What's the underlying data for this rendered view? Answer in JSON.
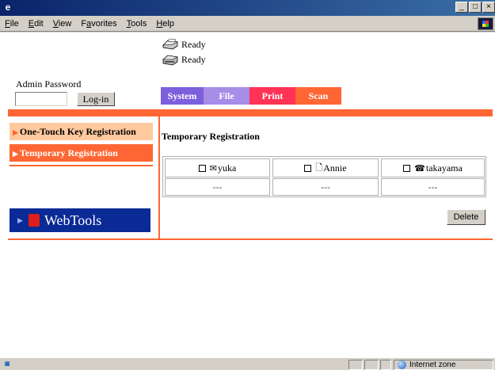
{
  "menu": {
    "items": [
      "File",
      "Edit",
      "View",
      "Favorites",
      "Tools",
      "Help"
    ],
    "underlines": [
      "F",
      "E",
      "V",
      "a",
      "T",
      "H"
    ]
  },
  "status": {
    "line1": "Ready",
    "line2": "Ready"
  },
  "admin": {
    "label": "Admin Password",
    "password_value": "",
    "login_label": "Log-in"
  },
  "tabs": [
    {
      "label": "System",
      "color": "#7b5fdc"
    },
    {
      "label": "File",
      "color": "#a78ce8"
    },
    {
      "label": "Print",
      "color": "#ff3355"
    },
    {
      "label": "Scan",
      "color": "#ff6633"
    }
  ],
  "sidebar": {
    "items": [
      {
        "label": "One-Touch Key Registration",
        "bg": "#ffc99e",
        "fg": "#000000",
        "arrow_color": "#ff6633"
      },
      {
        "label": "Temporary Registration",
        "bg": "#ff6633",
        "fg": "#ffffff",
        "arrow_color": "#ffffff"
      }
    ],
    "webtools_label": "WebTools"
  },
  "main": {
    "title": "Temporary Registration",
    "registrations": [
      {
        "name": "yuka",
        "icon": "mail-icon",
        "glyph": "✉"
      },
      {
        "name": "Annie",
        "icon": "document-icon",
        "glyph": "🗋"
      },
      {
        "name": "takayama",
        "icon": "fax-icon",
        "glyph": "☎"
      }
    ],
    "empty_row": [
      "---",
      "---",
      "---"
    ],
    "delete_label": "Delete"
  },
  "statusbar": {
    "zone": "Internet zone"
  },
  "colors": {
    "accent": "#ff6633",
    "titlebar": "#0a246a",
    "webtools_bg": "#0a2a96"
  }
}
